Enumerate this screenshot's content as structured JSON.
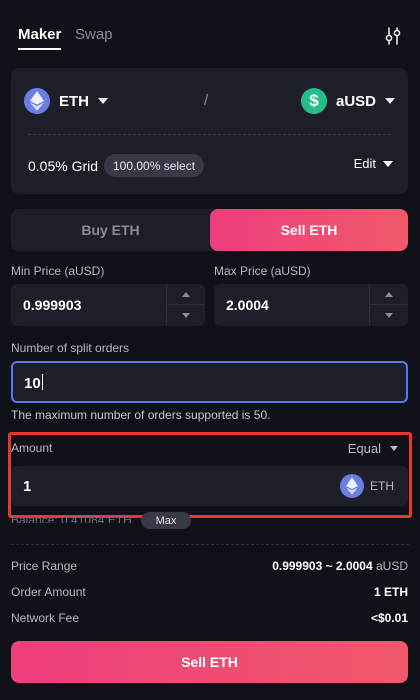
{
  "tabs": {
    "maker": "Maker",
    "swap": "Swap"
  },
  "pair": {
    "base_token": "ETH",
    "quote_token": "aUSD",
    "quote_icon_glyph": "$",
    "separator": "/",
    "grid_text": "0.05% Grid",
    "select_badge": "100.00% select",
    "edit_label": "Edit"
  },
  "toggle": {
    "buy": "Buy ETH",
    "sell": "Sell ETH",
    "active": "sell"
  },
  "price": {
    "min_label": "Min Price (aUSD)",
    "min_value": "0.999903",
    "max_label": "Max Price (aUSD)",
    "max_value": "2.0004"
  },
  "split": {
    "label": "Number of split orders",
    "value": "10",
    "hint": "The maximum number of orders supported is 50."
  },
  "amount": {
    "label": "Amount",
    "distribution": "Equal",
    "value": "1",
    "token": "ETH",
    "balance_text": "Balance: 0.41084 ETH",
    "max_label": "Max"
  },
  "summary": {
    "price_range_label": "Price Range",
    "price_range_value": "0.999903 ~ 2.0004",
    "price_range_unit": "aUSD",
    "order_amount_label": "Order Amount",
    "order_amount_value": "1 ETH",
    "network_fee_label": "Network Fee",
    "network_fee_value": "<$0.01"
  },
  "submit_label": "Sell ETH",
  "colors": {
    "background": "#101018",
    "card": "#1e1e29",
    "accent_gradient_start": "#ee3e7d",
    "accent_gradient_end": "#f0596a",
    "focus_border": "#5877f0",
    "highlight_border": "#e8382c",
    "eth": "#6a7fe6",
    "ausd": "#21c08a"
  }
}
